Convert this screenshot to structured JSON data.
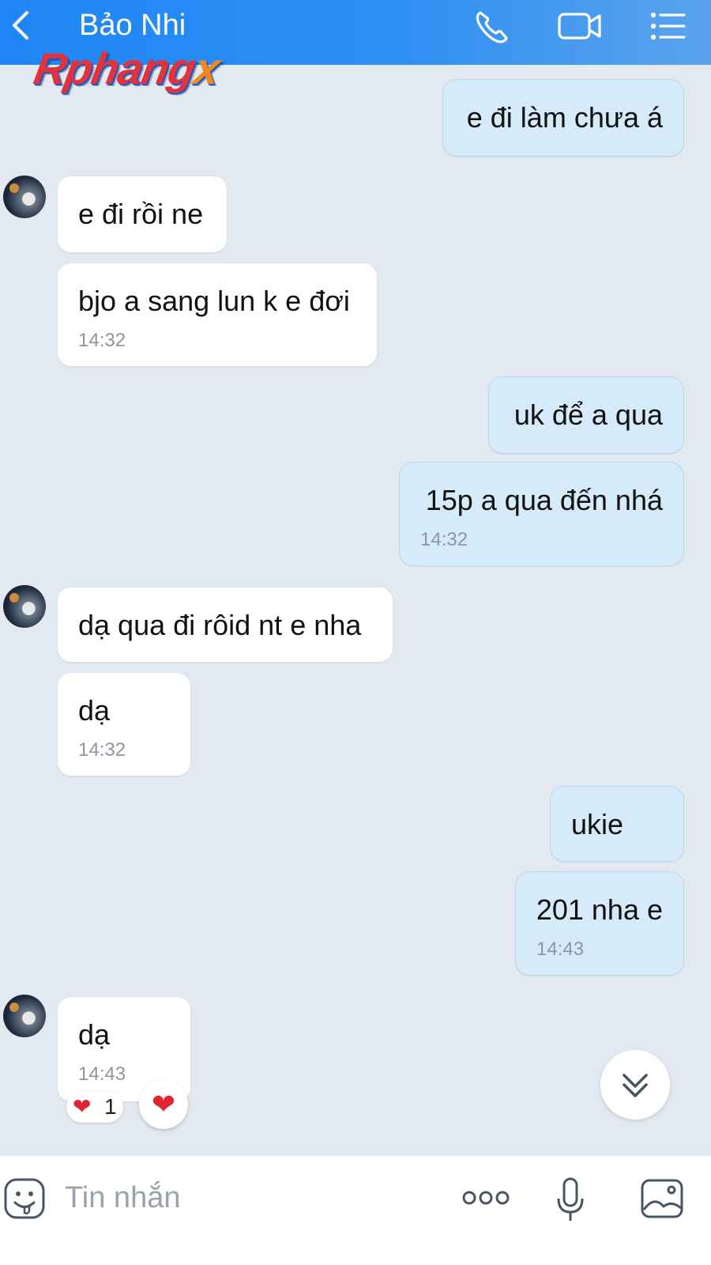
{
  "header": {
    "contact_name": "Bảo Nhi",
    "watermark_text": "Rphang",
    "watermark_x": "x",
    "icons": [
      "back-icon",
      "phone-icon",
      "video-call-icon",
      "menu-list-icon"
    ],
    "color": "#2e8ff3"
  },
  "messages": [
    {
      "dir": "out",
      "text": "e đi làm chưa á",
      "time": ""
    },
    {
      "dir": "in",
      "text": "e đi rồi ne",
      "time": "",
      "avatar": true
    },
    {
      "dir": "in",
      "text": "bjo a sang lun k e đơi",
      "time": "14:32"
    },
    {
      "dir": "out",
      "text": "uk để a qua",
      "time": ""
    },
    {
      "dir": "out",
      "text": "15p a qua đến nhá",
      "time": "14:32"
    },
    {
      "dir": "in",
      "text": "dạ qua đi rôid nt e nha",
      "time": "",
      "avatar": true
    },
    {
      "dir": "in",
      "text": "dạ",
      "time": "14:32"
    },
    {
      "dir": "out",
      "text": "ukie",
      "time": ""
    },
    {
      "dir": "out",
      "text": "201 nha e",
      "time": "14:43"
    },
    {
      "dir": "in",
      "text": "dạ",
      "time": "14:43",
      "avatar": true
    }
  ],
  "reaction": {
    "emoji": "❤",
    "count": "1"
  },
  "react_button": {
    "emoji": "❤"
  },
  "input": {
    "placeholder": "Tin nhắn",
    "value": ""
  },
  "bubble_colors": {
    "incoming": "#ffffff",
    "outgoing": "#d6ebfa"
  }
}
